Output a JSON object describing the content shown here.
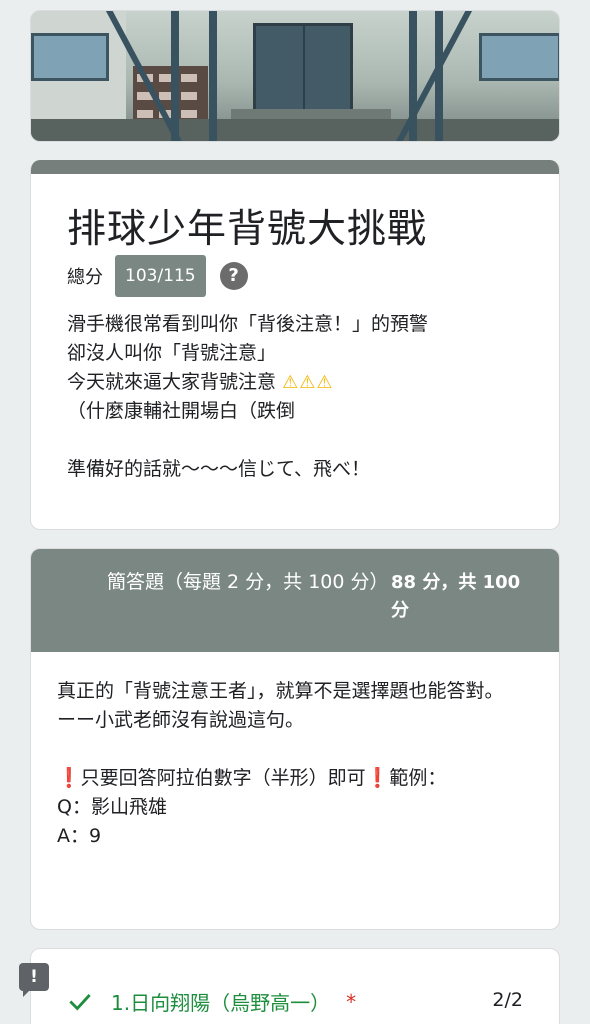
{
  "form": {
    "title": "排球少年背號大挑戰",
    "score_label": "總分",
    "score_value": "103/115",
    "help_icon_glyph": "?",
    "description_lines": [
      "滑手機很常看到叫你「背後注意！」的預警",
      "卻沒人叫你「背號注意」",
      "今天就來逼大家背號注意",
      "（什麼康輔社開場白（跌倒",
      "",
      "準備好的話就～～～信じて、飛べ！"
    ],
    "warn_icons": "⚠⚠⚠"
  },
  "section": {
    "title": "簡答題（每題 2 分，共 100 分）",
    "score": "88 分，共 100 分",
    "body_lines": [
      "真正的「背號注意王者」，就算不是選擇題也能答對。",
      "ーー小武老師沒有說過這句。",
      "",
      "只要回答阿拉伯數字（半形）即可",
      "範例：",
      "Q：影山飛雄",
      "A：9"
    ],
    "exclaim_glyph": "❗"
  },
  "question": {
    "title": "1.日向翔陽（烏野高一）",
    "required_mark": "*",
    "points": "2/2"
  },
  "feedback_glyph": "!",
  "colors": {
    "header_gray": "#7b8783",
    "correct_green": "#1e8e3e",
    "required_red": "#d93025",
    "warning_yellow": "#f4b400"
  }
}
